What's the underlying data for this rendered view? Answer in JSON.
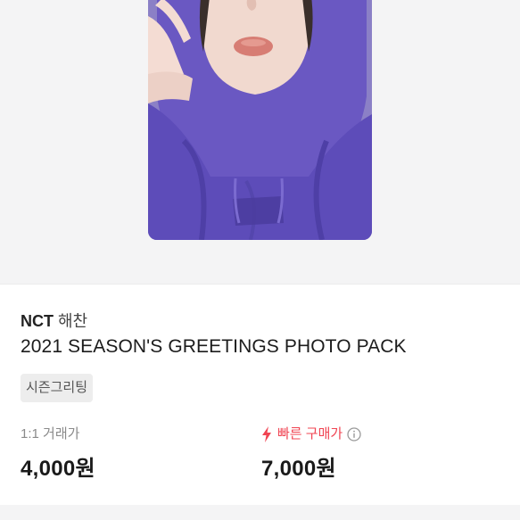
{
  "product": {
    "group": "NCT",
    "member": "해찬",
    "title": "2021 SEASON'S GREETINGS PHOTO PACK",
    "tag": "시즌그리팅"
  },
  "prices": {
    "trade_label": "1:1 거래가",
    "trade_value": "4,000원",
    "fast_label": "빠른 구매가",
    "fast_value": "7,000원"
  },
  "icons": {
    "fast": "lightning-bolt-icon",
    "info": "info-circle-icon"
  },
  "colors": {
    "accent": "#f04452",
    "hoodie": "#6d5dc1"
  }
}
